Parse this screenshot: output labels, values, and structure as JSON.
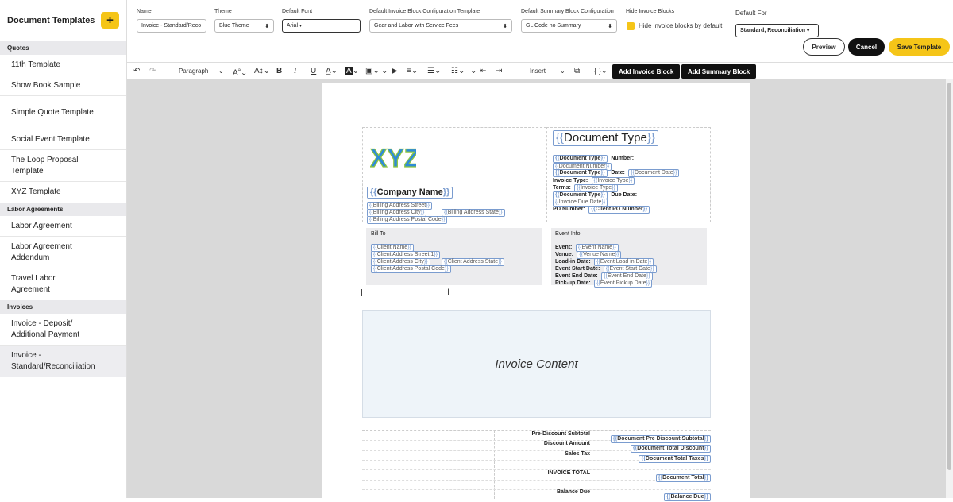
{
  "sidebar": {
    "title": "Document Templates",
    "add_label": "+",
    "sections": [
      {
        "label": "Quotes",
        "items": [
          "11th Template",
          "Show Book Sample",
          "Simple Quote Template",
          "Social Event Template",
          "The Loop Proposal Template",
          "XYZ Template"
        ]
      },
      {
        "label": "Labor Agreements",
        "items": [
          "Labor Agreement",
          "Labor Agreement Addendum",
          "Travel Labor Agreement"
        ]
      },
      {
        "label": "Invoices",
        "items": [
          "Invoice - Deposit/ Additional Payment",
          "Invoice - Standard/Reconciliation"
        ]
      }
    ]
  },
  "topbar": {
    "name_label": "Name",
    "name_value": "Invoice - Standard/Reco",
    "theme_label": "Theme",
    "theme_value": "Blue Theme",
    "font_label": "Default Font",
    "font_value": "Arial",
    "invoice_block_label": "Default Invoice Block Configuration Template",
    "invoice_block_value": "Gear and Labor with Service Fees",
    "summary_block_label": "Default Summary Block Configuration",
    "summary_block_value": "GL Code no Summary",
    "hide_label": "Hide Invoice Blocks",
    "hide_checkbox_label": "Hide invoice blocks by default",
    "default_for_label": "Default For",
    "default_for_value": "Standard, Reconciliation",
    "preview": "Preview",
    "cancel": "Cancel",
    "save": "Save Template"
  },
  "toolbar": {
    "paragraph": "Paragraph",
    "insert": "Insert",
    "add_invoice_block": "Add Invoice Block",
    "add_summary_block": "Add Summary Block"
  },
  "document": {
    "logo": "XYZ",
    "document_type_heading": "Document Type",
    "company_name": "Company Name",
    "billing_street": "Billing Address Street",
    "billing_city": "Billing Address City",
    "billing_state": "Billing Address State",
    "billing_postal": "Billing Address Postal Code",
    "number_label": "Number:",
    "document_type": "Document Type",
    "document_number": "Document Number",
    "date_label": "Date:",
    "document_date": "Document Date",
    "invoice_type_label": "Invoice Type:",
    "invoice_type": "Invoice Type",
    "terms_label": "Terms:",
    "due_date_label": "Due Date:",
    "invoice_due_date": "Invoice Due Date",
    "po_label": "PO Number:",
    "client_po": "Client PO Number",
    "bill_to": "Bill To",
    "client_name": "Client Name",
    "client_street": "Client Address Street 1",
    "client_city": "Client Address City",
    "client_state": "Client Address State",
    "client_postal": "Client Address Postal Code",
    "event_info": "Event Info",
    "event_label": "Event:",
    "event_name": "Event Name",
    "venue_label": "Venue:",
    "venue_name": "Venue Name",
    "loadin_label": "Load-in Date:",
    "loadin_date": "Event Load in Date",
    "start_label": "Event Start Date:",
    "start_date": "Event Start Date",
    "end_label": "Event End Date:",
    "end_date": "Event End Date",
    "pickup_label": "Pick-up Date:",
    "pickup_date": "Event Pickup Date",
    "invoice_content": "Invoice Content",
    "pre_discount_label": "Pre-Discount Subtotal",
    "pre_discount": "Document Pre Discount Subtotal",
    "discount_label": "Discount Amount",
    "discount": "Document Total Discount",
    "tax_label": "Sales Tax",
    "tax": "Document Total Taxes",
    "total_label": "INVOICE TOTAL",
    "total": "Document Total",
    "balance_label": "Balance Due",
    "balance": "Balance Due"
  },
  "colors": {
    "accent": "#f5c518",
    "chip_border": "#7a9ccf",
    "canvas": "#d9d9d9"
  }
}
